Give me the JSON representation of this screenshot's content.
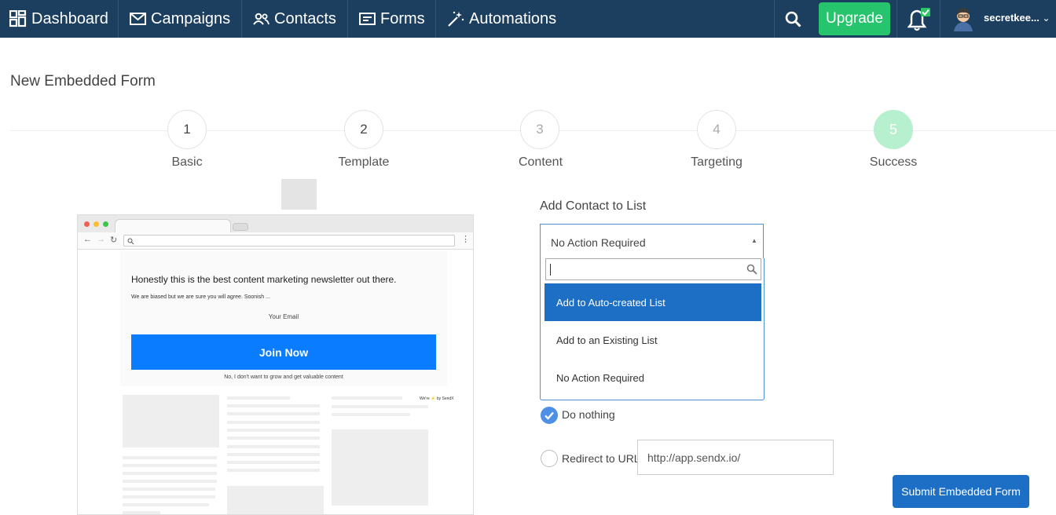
{
  "nav": {
    "items": [
      {
        "label": "Dashboard",
        "icon": "dashboard-icon"
      },
      {
        "label": "Campaigns",
        "icon": "envelope-icon"
      },
      {
        "label": "Contacts",
        "icon": "users-icon"
      },
      {
        "label": "Forms",
        "icon": "form-icon"
      },
      {
        "label": "Automations",
        "icon": "magic-wand-icon"
      }
    ],
    "upgrade_label": "Upgrade",
    "user_name": "secretkee..."
  },
  "page_title": "New Embedded Form",
  "steps": [
    {
      "number": "1",
      "label": "Basic"
    },
    {
      "number": "2",
      "label": "Template"
    },
    {
      "number": "3",
      "label": "Content"
    },
    {
      "number": "4",
      "label": "Targeting"
    },
    {
      "number": "5",
      "label": "Success"
    }
  ],
  "preview": {
    "headline": "Honestly this is the best content marketing newsletter out there.",
    "subtext": "We are biased but we are sure you will agree. Soonish ...",
    "email_label": "Your Email",
    "join_label": "Join Now",
    "decline_text": "No, I don't want to grow and get valuable content",
    "branding": "We're ⚡ by SendX"
  },
  "list_section": {
    "label": "Add Contact to List",
    "selected": "No Action Required",
    "search_value": "",
    "options": [
      "Add to Auto-created List",
      "Add to an Existing List",
      "No Action Required"
    ],
    "highlighted_index": 0
  },
  "redirect": {
    "option_nothing": "Do nothing",
    "option_url": "Redirect to URL",
    "url_value": "http://app.sendx.io/"
  },
  "submit_label": "Submit Embedded Form",
  "colors": {
    "navbar": "#1c3f5f",
    "upgrade": "#27c46e",
    "primary": "#1c6fc5",
    "step_active": "#b7f0cf",
    "preview_button": "#0a7cff"
  }
}
